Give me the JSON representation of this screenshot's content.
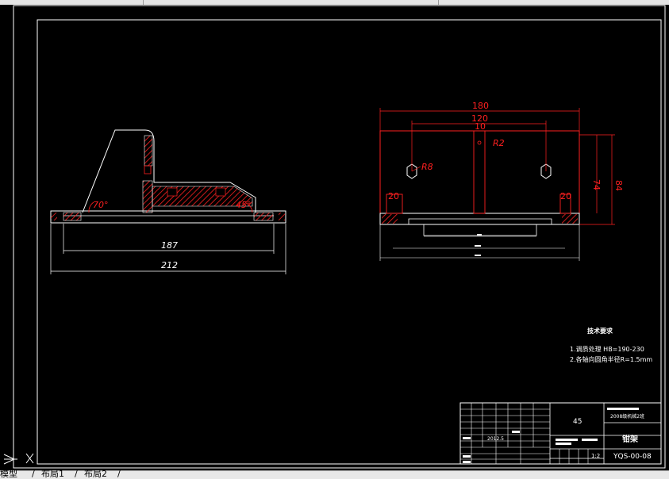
{
  "tabs": [
    {
      "label": "模型"
    },
    {
      "label": "布局1"
    },
    {
      "label": "布局2"
    }
  ],
  "drawing": {
    "side_view": {
      "angle_left": "70°",
      "angle_right": "45°",
      "dim_inner": "187",
      "dim_outer": "212"
    },
    "front_view": {
      "dim_width": "180",
      "dim_hole_spacing": "120",
      "dim_slot": "10",
      "radius_small": "R2",
      "radius_hole": "R8",
      "dim_left_block": "20",
      "dim_right_block": "20",
      "dim_height_inner": "74",
      "dim_height_outer": "84"
    },
    "tech_requirements": {
      "heading": "技术要求",
      "line1": "1.调质处理 HB=190-230",
      "line2": "2.各轴向圆角半径R=1.5mm"
    },
    "title_block": {
      "material": "45",
      "part_name": "钳架",
      "drawing_no": "YQS-00-08",
      "date": "2012.5",
      "scale": "1:2",
      "school_line": "2008级机械2班"
    }
  },
  "colors": {
    "background": "#000000",
    "outline": "#ffffff",
    "detail": "#ff0000"
  }
}
